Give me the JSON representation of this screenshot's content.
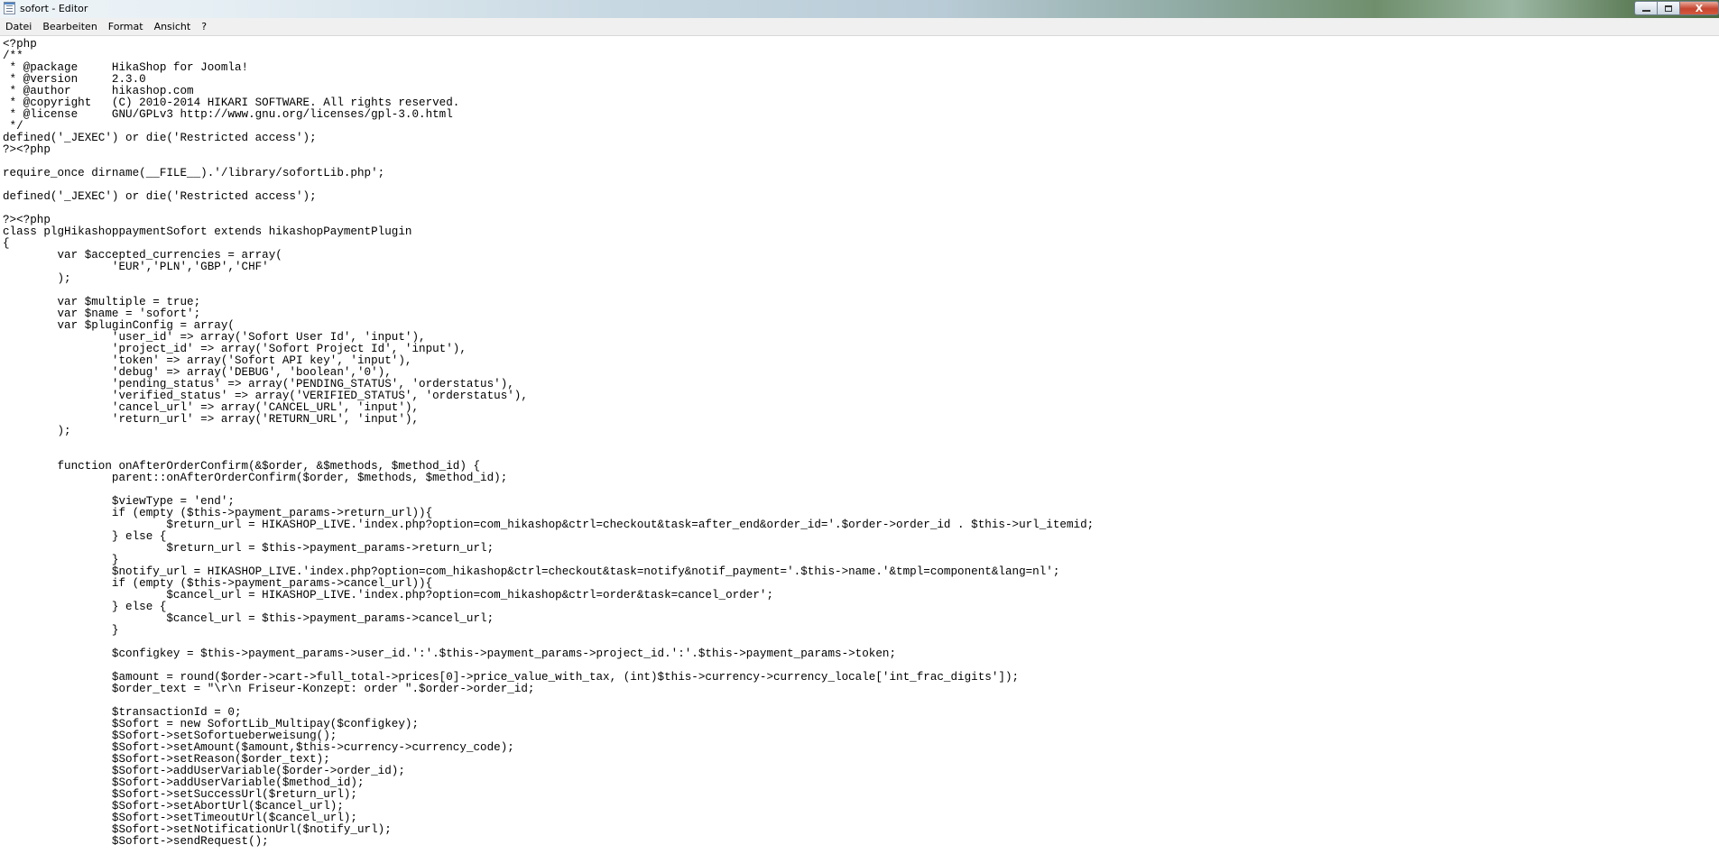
{
  "window": {
    "title": "sofort - Editor",
    "controls": {
      "minimize": "",
      "maximize": "",
      "close": "X"
    }
  },
  "menu": [
    "Datei",
    "Bearbeiten",
    "Format",
    "Ansicht",
    "?"
  ],
  "editor": {
    "lines": [
      "<?php",
      "/**",
      " * @package     HikaShop for Joomla!",
      " * @version     2.3.0",
      " * @author      hikashop.com",
      " * @copyright   (C) 2010-2014 HIKARI SOFTWARE. All rights reserved.",
      " * @license     GNU/GPLv3 http://www.gnu.org/licenses/gpl-3.0.html",
      " */",
      "defined('_JEXEC') or die('Restricted access');",
      "?><?php",
      "",
      "require_once dirname(__FILE__).'/library/sofortLib.php';",
      "",
      "defined('_JEXEC') or die('Restricted access');",
      "",
      "?><?php",
      "class plgHikashoppaymentSofort extends hikashopPaymentPlugin",
      "{",
      "\tvar $accepted_currencies = array(",
      "\t\t'EUR','PLN','GBP','CHF'",
      "\t);",
      "",
      "\tvar $multiple = true;",
      "\tvar $name = 'sofort';",
      "\tvar $pluginConfig = array(",
      "\t\t'user_id' => array('Sofort User Id', 'input'),",
      "\t\t'project_id' => array('Sofort Project Id', 'input'),",
      "\t\t'token' => array('Sofort API key', 'input'),",
      "\t\t'debug' => array('DEBUG', 'boolean','0'),",
      "\t\t'pending_status' => array('PENDING_STATUS', 'orderstatus'),",
      "\t\t'verified_status' => array('VERIFIED_STATUS', 'orderstatus'),",
      "\t\t'cancel_url' => array('CANCEL_URL', 'input'),",
      "\t\t'return_url' => array('RETURN_URL', 'input'),",
      "\t);",
      "",
      "",
      "\tfunction onAfterOrderConfirm(&$order, &$methods, $method_id) {",
      "\t\tparent::onAfterOrderConfirm($order, $methods, $method_id);",
      "",
      "\t\t$viewType = 'end';",
      "\t\tif (empty ($this->payment_params->return_url)){",
      "\t\t\t$return_url = HIKASHOP_LIVE.'index.php?option=com_hikashop&ctrl=checkout&task=after_end&order_id='.$order->order_id . $this->url_itemid;",
      "\t\t} else {",
      "\t\t\t$return_url = $this->payment_params->return_url;",
      "\t\t}",
      "\t\t$notify_url = HIKASHOP_LIVE.'index.php?option=com_hikashop&ctrl=checkout&task=notify&notif_payment='.$this->name.'&tmpl=component&lang=nl';",
      "\t\tif (empty ($this->payment_params->cancel_url)){",
      "\t\t\t$cancel_url = HIKASHOP_LIVE.'index.php?option=com_hikashop&ctrl=order&task=cancel_order';",
      "\t\t} else {",
      "\t\t\t$cancel_url = $this->payment_params->cancel_url;",
      "\t\t}",
      "",
      "\t\t$configkey = $this->payment_params->user_id.':'.$this->payment_params->project_id.':'.$this->payment_params->token;",
      "",
      "\t\t$amount = round($order->cart->full_total->prices[0]->price_value_with_tax, (int)$this->currency->currency_locale['int_frac_digits']);",
      "\t\t$order_text = \"\\r\\n Friseur-Konzept: order \".$order->order_id;",
      "",
      "\t\t$transactionId = 0;",
      "\t\t$Sofort = new SofortLib_Multipay($configkey);",
      "\t\t$Sofort->setSofortueberweisung();",
      "\t\t$Sofort->setAmount($amount,$this->currency->currency_code);",
      "\t\t$Sofort->setReason($order_text);",
      "\t\t$Sofort->addUserVariable($order->order_id);",
      "\t\t$Sofort->addUserVariable($method_id);",
      "\t\t$Sofort->setSuccessUrl($return_url);",
      "\t\t$Sofort->setAbortUrl($cancel_url);",
      "\t\t$Sofort->setTimeoutUrl($cancel_url);",
      "\t\t$Sofort->setNotificationUrl($notify_url);",
      "\t\t$Sofort->sendRequest();"
    ]
  }
}
